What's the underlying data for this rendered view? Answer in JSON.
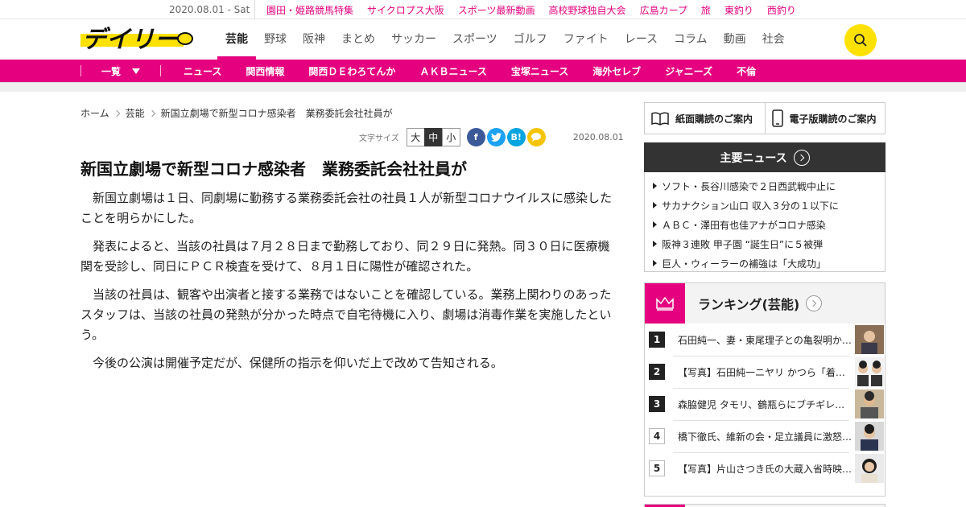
{
  "topbar": {
    "date": "2020.08.01 - Sat",
    "links": [
      "園田・姫路競馬特集",
      "サイクロプス大阪",
      "スポーツ最新動画",
      "高校野球独自大会",
      "広島カープ",
      "旅",
      "東釣り",
      "西釣り"
    ]
  },
  "brand": {
    "logo_text": "デイリー",
    "accent": "#e4007f",
    "logo_yellow": "#ffe100"
  },
  "mainnav": {
    "items": [
      "芸能",
      "野球",
      "阪神",
      "まとめ",
      "サッカー",
      "スポーツ",
      "ゴルフ",
      "ファイト",
      "レース",
      "コラム",
      "動画",
      "社会"
    ],
    "active": "芸能",
    "search_icon": "search-icon"
  },
  "subnav": {
    "list_label": "一覧",
    "items": [
      "ニュース",
      "関西情報",
      "関西ＤＥわろてんか",
      "ＡＫＢニュース",
      "宝塚ニュース",
      "海外セレブ",
      "ジャニーズ",
      "不倫"
    ]
  },
  "breadcrumb": [
    "ホーム",
    "芸能",
    "新国立劇場で新型コロナ感染者　業務委託会社社員が"
  ],
  "tools": {
    "font_size_label": "文字サイズ",
    "sizes": [
      "大",
      "中",
      "小"
    ],
    "selected": "中",
    "share": [
      "f",
      "t",
      "B!",
      "chat"
    ],
    "date": "2020.08.01"
  },
  "article": {
    "title": "新国立劇場で新型コロナ感染者　業務委託会社社員が",
    "paragraphs": [
      "新国立劇場は１日、同劇場に勤務する業務委託会社の社員１人が新型コロナウイルスに感染したことを明らかにした。",
      "発表によると、当該の社員は７月２８日まで勤務しており、同２９日に発熱。同３０日に医療機関を受診し、同日にＰＣＲ検査を受けて、８月１日に陽性が確認された。",
      "当該の社員は、観客や出演者と接する業務ではないことを確認している。業務上関わりのあったスタッフは、当該の社員の発熱が分かった時点で自宅待機に入り、劇場は消毒作業を実施したという。",
      "今後の公演は開催予定だが、保健所の指示を仰いだ上で改めて告知される。"
    ]
  },
  "sidebar": {
    "paper_sub": "紙面購読のご案内",
    "digital_sub": "電子版購読のご案内",
    "news_title": "主要ニュース",
    "news": [
      "ソフト・長谷川感染で２日西武戦中止に",
      "サカナクション山口 収入３分の１以下に",
      "ＡＢＣ・澤田有也佳アナがコロナ感染",
      "阪神３連敗 甲子園 “誕生日”に５被弾",
      "巨人・ウィーラーの補強は「大成功」"
    ],
    "ranking_title": "ランキング(芸能)",
    "ranking": [
      {
        "rank": "1",
        "text": "石田純一、妻・東尾理子との亀裂明か…"
      },
      {
        "rank": "2",
        "text": "【写真】石田純一ニヤリ かつら「着…"
      },
      {
        "rank": "3",
        "text": "森脇健児 タモリ、鶴瓶らにブチギレ…"
      },
      {
        "rank": "4",
        "text": "橋下徹氏、維新の会・足立議員に激怒…"
      },
      {
        "rank": "5",
        "text": "【写真】片山さつき氏の大蔵入省時映…"
      }
    ]
  }
}
